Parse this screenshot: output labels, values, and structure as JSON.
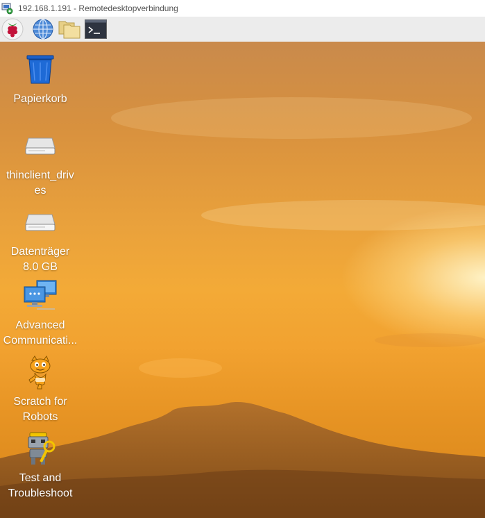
{
  "window": {
    "title": "192.168.1.191 - Remotedesktopverbindung",
    "icon": "remote-desktop-icon"
  },
  "taskbar": {
    "items": [
      {
        "name": "raspberry-menu",
        "icon": "raspberry-pi-icon"
      },
      {
        "name": "web-browser",
        "icon": "globe-icon"
      },
      {
        "name": "file-manager",
        "icon": "folders-icon"
      },
      {
        "name": "terminal",
        "icon": "terminal-icon"
      }
    ]
  },
  "desktop": {
    "icons": [
      {
        "name": "trash",
        "line1": "Papierkorb",
        "line2": "",
        "icon": "trash-bin-icon"
      },
      {
        "name": "thinclient-drives",
        "line1": "thinclient_driv",
        "line2": "es",
        "icon": "drive-icon"
      },
      {
        "name": "datentraeger",
        "line1": "Datenträger",
        "line2": "8.0 GB",
        "icon": "drive-icon"
      },
      {
        "name": "advanced-communication",
        "line1": "Advanced",
        "line2": "Communicati...",
        "icon": "network-computers-icon"
      },
      {
        "name": "scratch-for-robots",
        "line1": "Scratch for",
        "line2": "Robots",
        "icon": "scratch-cat-icon"
      },
      {
        "name": "test-and-troubleshoot",
        "line1": "Test and",
        "line2": "Troubleshoot",
        "icon": "robot-wrench-icon"
      }
    ]
  },
  "colors": {
    "sky_top": "#c98a4c",
    "sky_mid": "#f3aa37",
    "sun_glow": "#fff6cd",
    "hill": "#7a4a1e",
    "taskbar_bg": "#ececec"
  }
}
